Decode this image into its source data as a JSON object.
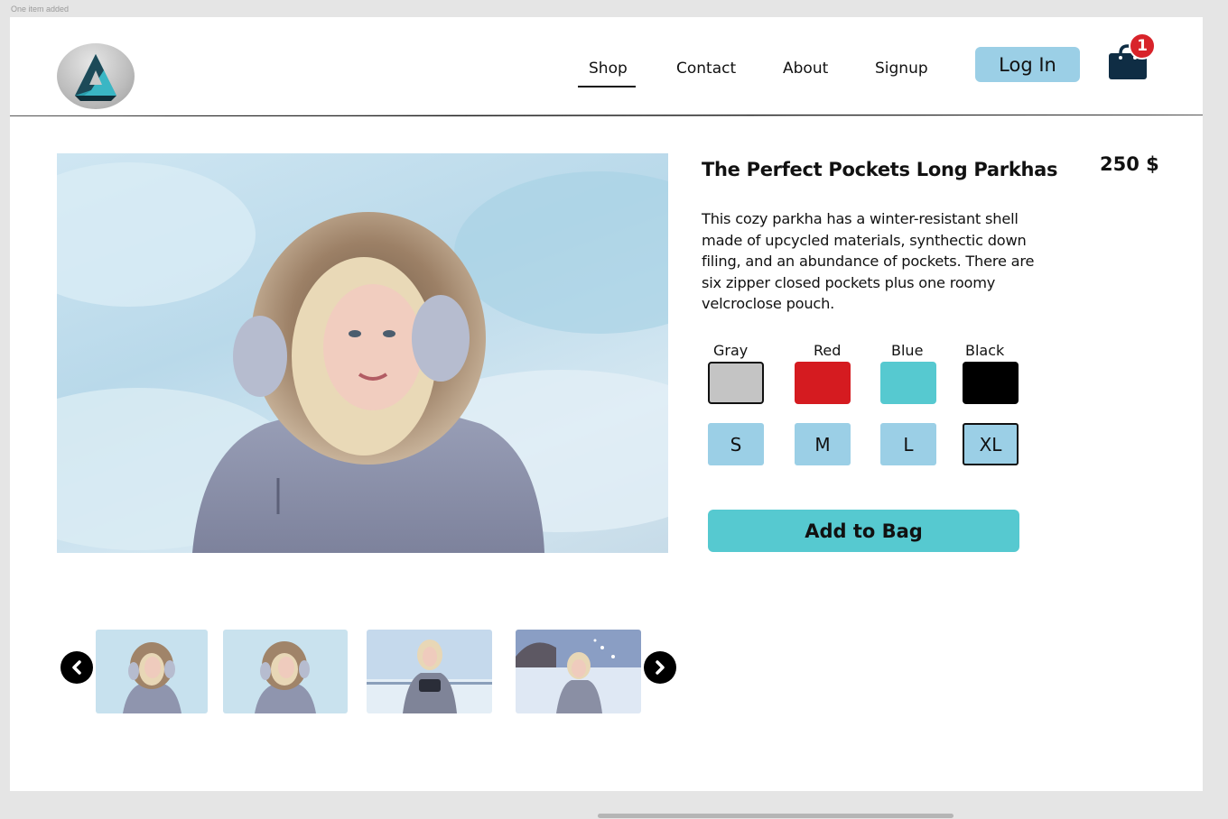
{
  "frame": {
    "label": "One item added"
  },
  "header": {
    "nav": [
      {
        "label": "Shop",
        "active": true
      },
      {
        "label": "Contact",
        "active": false
      },
      {
        "label": "About",
        "active": false
      },
      {
        "label": "Signup",
        "active": false
      }
    ],
    "login_label": "Log In",
    "cart_count": "1"
  },
  "product": {
    "title": "The Perfect Pockets Long Parkhas",
    "price": "250 $",
    "description": "This cozy parkha has a winter-resistant shell made of upcycled materials, synthectic down filing, and an abundance of pockets. There are six zipper closed pockets plus one roomy velcroclose pouch.",
    "colors": [
      {
        "label": "Gray",
        "hex": "#c4c4c4",
        "selected": true
      },
      {
        "label": "Red",
        "hex": "#d51b20",
        "selected": false
      },
      {
        "label": "Blue",
        "hex": "#56c9d0",
        "selected": false
      },
      {
        "label": "Black",
        "hex": "#000000",
        "selected": false
      }
    ],
    "sizes": [
      {
        "label": "S",
        "selected": false
      },
      {
        "label": "M",
        "selected": false
      },
      {
        "label": "L",
        "selected": false
      },
      {
        "label": "XL",
        "selected": true
      }
    ],
    "add_to_bag_label": "Add to Bag"
  },
  "gallery": {
    "thumbnails": [
      "woman-fur-hood-snow-1",
      "woman-fur-hood-snow-2",
      "woman-camera-snow",
      "woman-snow-field"
    ]
  },
  "colors": {
    "accent_light_blue": "#9bcfe6",
    "accent_teal": "#56c9d0",
    "badge_red": "#d8232a"
  }
}
